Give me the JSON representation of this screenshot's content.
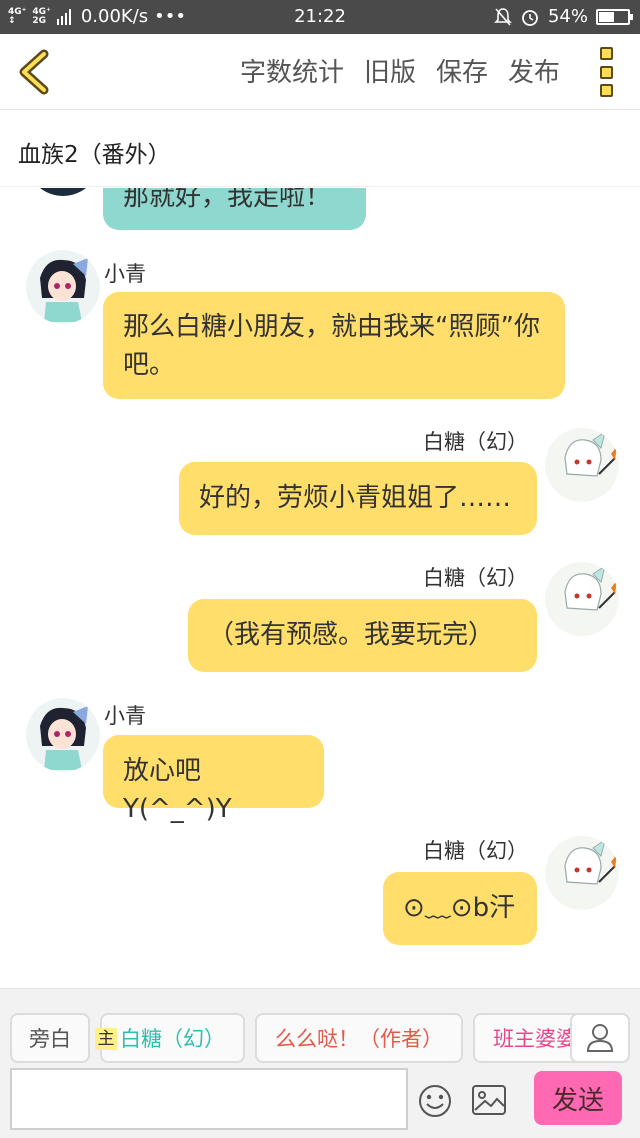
{
  "status_bar": {
    "signal1": "4G⁺",
    "signal2": "4G⁺",
    "signal3": "2G",
    "speed": "0.00K/s",
    "dots": "•••",
    "time": "21:22",
    "battery": "54%",
    "battery_level": 0.54
  },
  "header": {
    "actions": [
      "字数统计",
      "旧版",
      "保存",
      "发布"
    ]
  },
  "title": "血族2（番外）",
  "messages": [
    {
      "side": "left",
      "name": "",
      "text": "那就好，我走啦！",
      "color": "teal"
    },
    {
      "side": "left",
      "name": "小青",
      "text": "那么白糖小朋友，就由我来“照顾”你吧。"
    },
    {
      "side": "right",
      "name": "白糖（幻）",
      "text": "好的，劳烦小青姐姐了……"
    },
    {
      "side": "right",
      "name": "白糖（幻）",
      "text": "（我有预感。我要玩完）"
    },
    {
      "side": "left",
      "name": "小青",
      "text": "放心吧Y(^_^)Y"
    },
    {
      "side": "right",
      "name": "白糖（幻）",
      "text": "⊙﹏⊙b汗"
    }
  ],
  "roles": {
    "narrator": "旁白",
    "badge": "主",
    "r1": "白糖（幻）",
    "r2": "么么哒！（作者）",
    "r3": "班主婆婆"
  },
  "input": {
    "placeholder": ""
  },
  "send_label": "发送"
}
